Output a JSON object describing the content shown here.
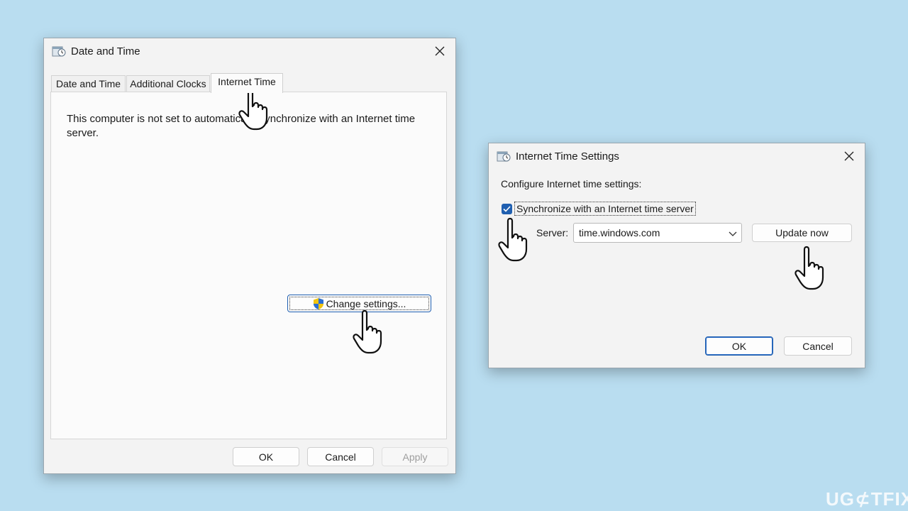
{
  "window_main": {
    "title": "Date and Time",
    "tabs": [
      {
        "label": "Date and Time",
        "active": false
      },
      {
        "label": "Additional Clocks",
        "active": false
      },
      {
        "label": "Internet Time",
        "active": true
      }
    ],
    "message": "This computer is not set to automatically synchronize with an Internet time server.",
    "change_settings_label": "Change settings...",
    "ok_label": "OK",
    "cancel_label": "Cancel",
    "apply_label": "Apply"
  },
  "window_internet_time": {
    "title": "Internet Time Settings",
    "configure_label": "Configure Internet time settings:",
    "sync_label": "Synchronize with an Internet time server",
    "sync_checked": true,
    "server_label": "Server:",
    "server_value": "time.windows.com",
    "update_now_label": "Update now",
    "ok_label": "OK",
    "cancel_label": "Cancel"
  },
  "watermark": "UG⊄TFIX",
  "icons": {
    "close": "close-icon",
    "clock": "date-time-icon",
    "shield": "uac-shield-icon",
    "pointer": "hand-pointer-icon",
    "dropdown": "chevron-down-icon"
  },
  "colors": {
    "background": "#b9ddf0",
    "accent": "#1f5fb0"
  }
}
